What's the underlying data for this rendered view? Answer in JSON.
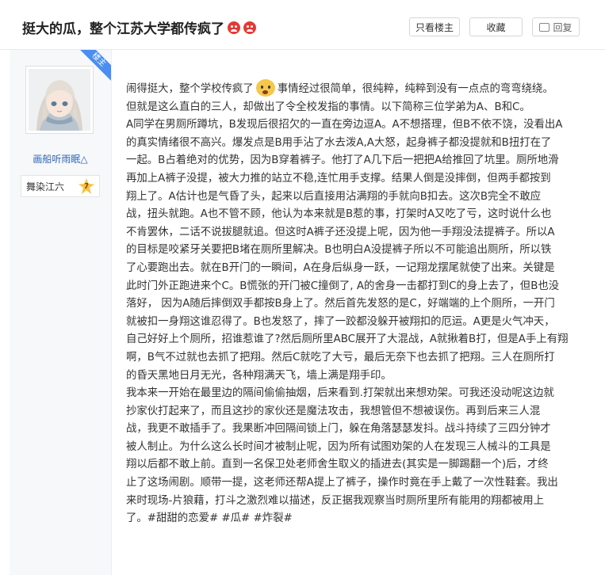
{
  "header": {
    "title": "挺大的瓜，整个江苏大学都传疯了",
    "buttons": {
      "only_host": "只看楼主",
      "favorite": "收藏",
      "reply": "回复"
    }
  },
  "sidebar": {
    "badge": "楼主",
    "username": "画船听雨眠△",
    "level_name": "舞染江六",
    "level_number": "7"
  },
  "post": {
    "lines": [
      "但就是这么直白的三人，却做出了令全校发指的事情。以下简称三位学弟为A、B和C。",
      "A同学在男厕所蹲坑，B发现后很招欠的一直在旁边逗A。A不想搭理，但B不依不饶，没看出A",
      "的真实情绪很不高兴。爆发点是B用手沾了水去泼A,A大怒，起身裤子都没提就和B扭打在了",
      "一起。B占着绝对的优势，因为B穿着裤子。他打了A几下后一把把A给推回了坑里。厕所地滑",
      "再加上A裤子没提，被大力推的站立不稳,连忙用手支撑。结果人倒是没摔倒，但两手都按到",
      "翔上了。A估计也是气昏了头，起来以后直接用沾满翔的手就向B扣去。这次B完全不敢应",
      "战，扭头就跑。A也不管不顾，他认为本来就是B惹的事，打架时A又吃了亏，这时说什么也",
      "不肯罢休，二话不说拔腿就追。但这时A裤子还没提上呢，因为他一手翔没法提裤子。所以A",
      "的目标是咬紧牙关要把B堵在厕所里解决。B也明白A没提裤子所以不可能追出厕所，所以铁",
      "了心要跑出去。就在B开门的一瞬间，A在身后纵身一跃，一记翔龙摆尾就使了出来。关键是",
      "此时门外正跑进来个C。B慌张的开门被C撞倒了, A的舍身一击都打到C的身上去了，但B也没",
      "落好， 因为A随后摔倒双手都按B身上了。然后首先发怒的是C，好端端的上个厕所，一开门",
      "就被扣一身翔这谁忍得了。B也发怒了，摔了一跤都没躲开被翔扣的厄运。A更是火气冲天，",
      "自己好好上个厕所，招谁惹谁了?然后厕所里ABC展开了大混战，A就揪着B打，但是A手上有翔",
      "啊，B气不过就也去抓了把翔。然后C就吃了大亏，最后无奈下也去抓了把翔。三人在厕所打",
      "的昏天黑地日月无光，各种翔满天飞，墙上满是翔手印。",
      "我本来一开始在最里边的隔间偷偷抽烟，后来看到.打架就出来想劝架。可我还没动呢这边就",
      "抄家伙打起来了，而且这抄的家伙还是魔法攻击，我想管但不想被误伤。再到后来三人混",
      "战，我更不敢插手了。我果断冲回隔间锁上门，躲在角落瑟瑟发抖。战斗持续了三四分钟才",
      "被人制止。为什么这么长时间才被制止呢，因为所有试图劝架的人在发现三人械斗的工具是",
      "翔以后都不敢上前。直到一名保卫处老师舍生取义的插进去(其实是一脚踢翻一个)后，才终",
      "止了这场闹剧。顺带一提，这老师还帮A提上了裤子，操作时竟在手上戴了一次性鞋套。我出",
      "来时现场-片狼藉，打斗之激烈难以描述，反正据我观察当时厕所里所有能用的翔都被用上",
      "了。#甜甜的恋爱# #瓜# #炸裂#"
    ],
    "first_line_before": "闹得挺大，整个学校传疯了",
    "first_line_after": "事情经过很简单，很纯粹，纯粹到没有一点点的弯弯绕绕。"
  }
}
